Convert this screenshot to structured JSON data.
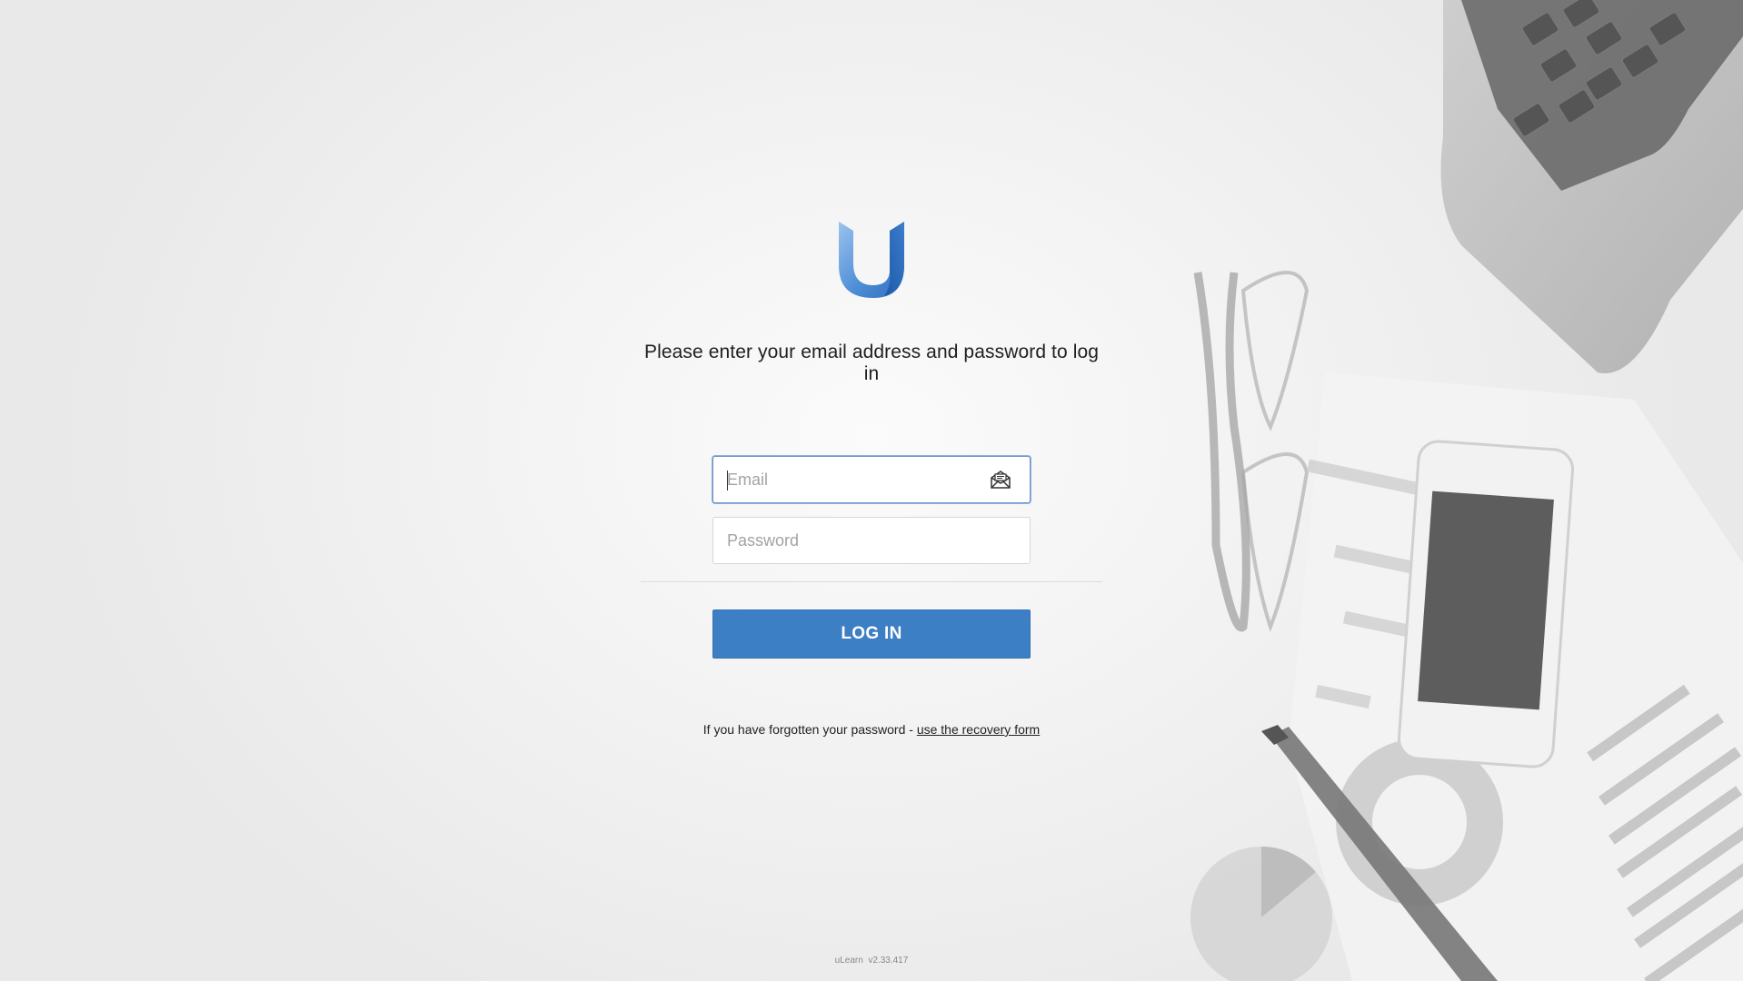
{
  "app": {
    "name": "uLearn",
    "version": "v2.33.417"
  },
  "login": {
    "prompt": "Please enter your email address and password to log in",
    "email_placeholder": "Email",
    "password_placeholder": "Password",
    "submit_label": "LOG IN",
    "recovery_text": "If you have forgotten your password - ",
    "recovery_link": "use the recovery form"
  },
  "icons": {
    "logo": "u-logo",
    "email": "envelope-open-icon"
  },
  "colors": {
    "accent": "#3d7fc4",
    "focus_border": "#6f95c7",
    "logo_blue": "#4f8fd6"
  }
}
